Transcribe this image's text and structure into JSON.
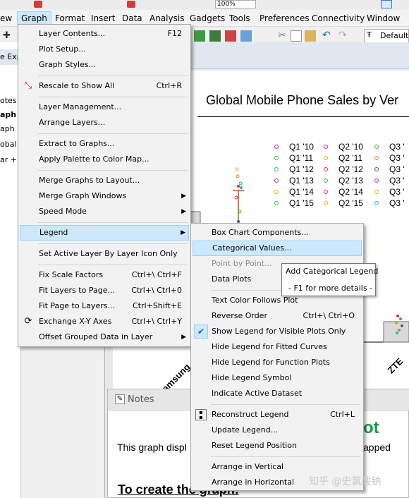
{
  "menubar": {
    "partial_left": "ew",
    "items": [
      "Graph",
      "Format",
      "Insert",
      "Data",
      "Analysis",
      "Gadgets",
      "Tools",
      "Preferences",
      "Connectivity",
      "Window"
    ],
    "zoom_value": "100%",
    "font_dropdown": "Default"
  },
  "left_panel": {
    "header": "e Expl",
    "items": [
      "otes",
      "aph",
      "aph",
      "obal",
      "ar +"
    ]
  },
  "graph": {
    "title": "Global Mobile Phone Sales by Ver",
    "legend_col1": [
      "Q1 '10",
      "Q1 '11",
      "Q1 '12",
      "Q1 '13",
      "Q1 '14",
      "Q1 '15"
    ],
    "legend_col2": [
      "Q2 '10",
      "Q2 '11",
      "Q2 '12",
      "Q2 '13",
      "Q2 '14",
      "Q2 '15"
    ],
    "legend_col3": [
      "Q3 '",
      "Q3 '",
      "Q3 '",
      "Q3 '",
      "Q3 '",
      "Q3 '"
    ],
    "legend_colors": [
      "#e0207a",
      "#36b436",
      "#20b2c8",
      "#e0207a",
      "#d4b400",
      "#36b436"
    ],
    "categories": [
      "Samsung",
      "ZTE"
    ]
  },
  "notes": {
    "title": "Notes",
    "line1": "This graph displ",
    "line1_end": "apped",
    "heading_partial": "ot",
    "heading2": "To create the graph:"
  },
  "graph_menu": {
    "items": [
      {
        "label": "Layer Contents...",
        "shortcut": "F12"
      },
      {
        "label": "Plot Setup...",
        "shortcut": ""
      },
      {
        "label": "Graph Styles...",
        "shortcut": ""
      },
      {
        "label": "Rescale to Show All",
        "shortcut": "Ctrl+R"
      },
      {
        "label": "Layer Management...",
        "shortcut": ""
      },
      {
        "label": "Arrange Layers...",
        "shortcut": ""
      },
      {
        "label": "Extract to Graphs...",
        "shortcut": ""
      },
      {
        "label": "Apply Palette to Color Map...",
        "shortcut": ""
      },
      {
        "label": "Merge Graphs to Layout...",
        "shortcut": ""
      },
      {
        "label": "Merge Graph Windows",
        "shortcut": ""
      },
      {
        "label": "Speed Mode",
        "shortcut": ""
      },
      {
        "label": "Legend",
        "shortcut": ""
      },
      {
        "label": "Set Active Layer By Layer Icon Only",
        "shortcut": ""
      },
      {
        "label": "Fix Scale Factors",
        "shortcut": "Ctrl+\\ Ctrl+F"
      },
      {
        "label": "Fit Layers to Page...",
        "shortcut": "Ctrl+\\ Ctrl+0"
      },
      {
        "label": "Fit Page to Layers...",
        "shortcut": "Ctrl+Shift+E"
      },
      {
        "label": "Exchange X-Y Axes",
        "shortcut": "Ctrl+\\ Ctrl+Y"
      },
      {
        "label": "Offset Grouped Data in Layer",
        "shortcut": ""
      }
    ]
  },
  "legend_menu": {
    "items": [
      {
        "label": "Box Chart Components...",
        "shortcut": ""
      },
      {
        "label": "Categorical Values...",
        "shortcut": ""
      },
      {
        "label": "Point by Point...",
        "shortcut": ""
      },
      {
        "label": "Data Plots",
        "shortcut": ""
      },
      {
        "label": "Text Color Follows Plot",
        "shortcut": ""
      },
      {
        "label": "Reverse Order",
        "shortcut": "Ctrl+\\ Ctrl+O"
      },
      {
        "label": "Show Legend for Visible Plots Only",
        "shortcut": ""
      },
      {
        "label": "Hide Legend for Fitted Curves",
        "shortcut": ""
      },
      {
        "label": "Hide Legend for Function Plots",
        "shortcut": ""
      },
      {
        "label": "Hide Legend Symbol",
        "shortcut": ""
      },
      {
        "label": "Indicate Active Dataset",
        "shortcut": ""
      },
      {
        "label": "Reconstruct Legend",
        "shortcut": "Ctrl+L"
      },
      {
        "label": "Update Legend...",
        "shortcut": ""
      },
      {
        "label": "Reset Legend Position",
        "shortcut": ""
      },
      {
        "label": "Arrange in Vertical",
        "shortcut": ""
      },
      {
        "label": "Arrange in Horizontal",
        "shortcut": ""
      }
    ]
  },
  "tooltip": {
    "line1": "Add Categorical Legend",
    "line2": "- F1 for more details -"
  },
  "watermark": "知乎 @史氯酸钠"
}
